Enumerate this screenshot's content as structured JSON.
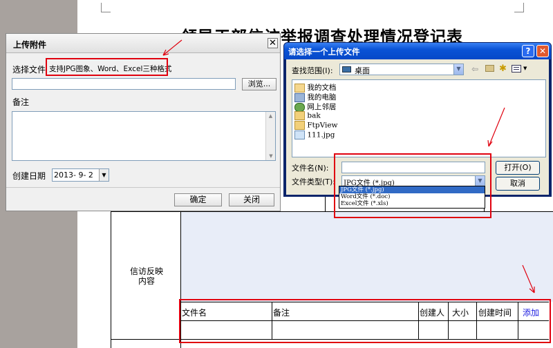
{
  "document": {
    "title": "领导干部信访举报调查处理情况登记表",
    "row_label": "信访反映\n内容",
    "attachment_table": {
      "headers": [
        "文件名",
        "备注",
        "创建人",
        "大小",
        "创建时间"
      ],
      "add_link": "添加"
    }
  },
  "upload_dialog": {
    "title": "上传附件",
    "select_file_label": "选择文件",
    "select_file_hint": "支持JPG图象、Word、Excel三种格式",
    "browse_button": "浏览...",
    "remark_label": "备注",
    "created_date_label": "创建日期",
    "created_date_value": "2013- 9- 2",
    "ok_button": "确定",
    "close_button": "关闭"
  },
  "file_dialog": {
    "title": "请选择一个上传文件",
    "lookin_label": "查找范围(I):",
    "lookin_value": "桌面",
    "items": [
      "我的文档",
      "我的电脑",
      "网上邻居",
      "bak",
      "FtpView",
      "111.jpg"
    ],
    "filename_label": "文件名(N):",
    "filename_value": "",
    "filetype_label": "文件类型(T):",
    "filetype_value": "JPG文件 (*.jpg)",
    "filetype_options": [
      "JPG文件 (*.jpg)",
      "Word文件 (*.doc)",
      "Excel文件 (*.xls)"
    ],
    "open_button": "打开(O)",
    "cancel_button": "取消"
  },
  "colors": {
    "annotation_red": "#e0000e",
    "xp_title_blue": "#0a53d6",
    "selection_blue": "#316ac5",
    "link_blue": "#0000ee"
  }
}
